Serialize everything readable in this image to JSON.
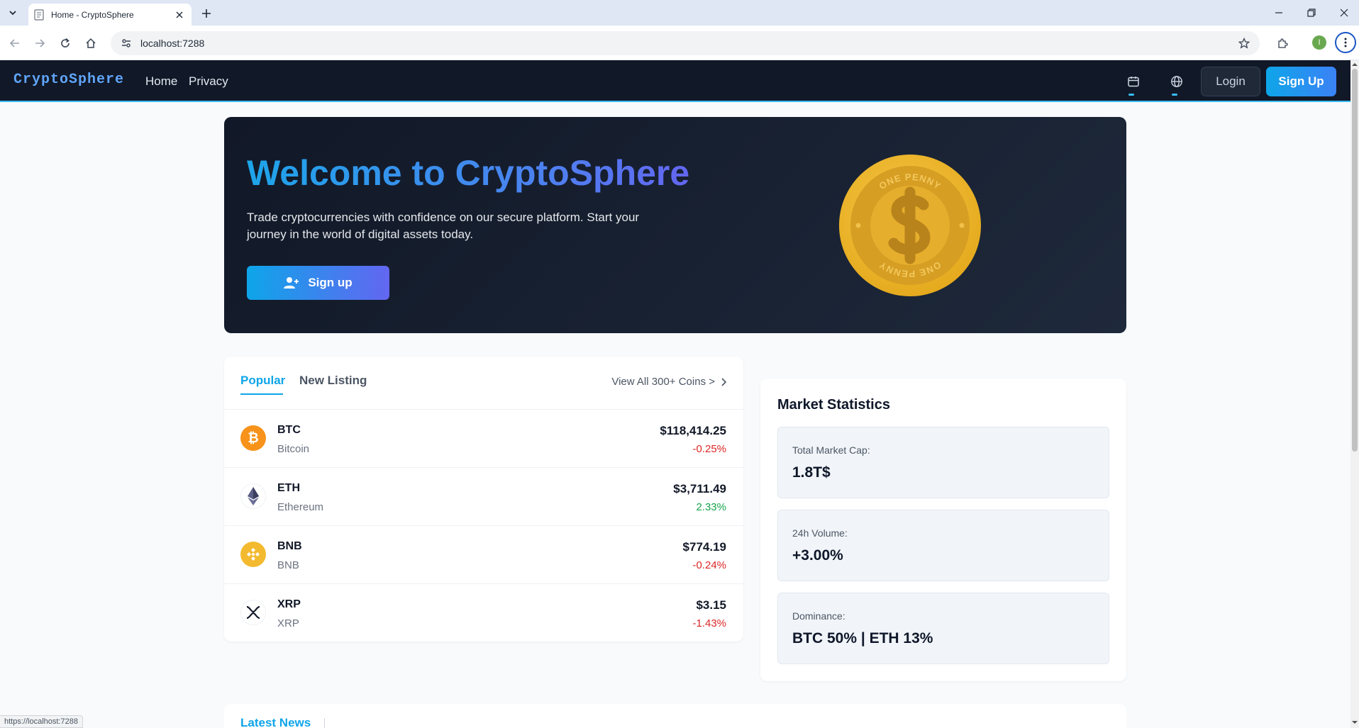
{
  "browser": {
    "tab_title": "Home - CryptoSphere",
    "url": "localhost:7288",
    "profile_initial": "I",
    "status_url": "https://localhost:7288"
  },
  "navbar": {
    "brand": "CryptoSphere",
    "links": [
      "Home",
      "Privacy"
    ],
    "login_label": "Login",
    "signup_label": "Sign Up"
  },
  "hero": {
    "title": "Welcome to CryptoSphere",
    "subtitle": "Trade cryptocurrencies with confidence on our secure platform. Start your journey in the world of digital assets today.",
    "button_label": "Sign up",
    "coin_top_text": "ONE PENNY",
    "coin_bottom_text": "ONE PENNY"
  },
  "coins": {
    "tabs": [
      "Popular",
      "New Listing"
    ],
    "active_tab": "Popular",
    "view_all": "View All 300+ Coins >",
    "rows": [
      {
        "symbol": "BTC",
        "name": "Bitcoin",
        "price": "$118,414.25",
        "change": "-0.25%",
        "direction": "down",
        "logo": "bitcoin-logo-icon"
      },
      {
        "symbol": "ETH",
        "name": "Ethereum",
        "price": "$3,711.49",
        "change": "2.33%",
        "direction": "up",
        "logo": "ethereum-logo-icon"
      },
      {
        "symbol": "BNB",
        "name": "BNB",
        "price": "$774.19",
        "change": "-0.24%",
        "direction": "down",
        "logo": "bnb-logo-icon"
      },
      {
        "symbol": "XRP",
        "name": "XRP",
        "price": "$3.15",
        "change": "-1.43%",
        "direction": "down",
        "logo": "xrp-logo-icon"
      }
    ]
  },
  "stats": {
    "title": "Market Statistics",
    "items": [
      {
        "label": "Total Market Cap:",
        "value": "1.8T$"
      },
      {
        "label": "24h Volume:",
        "value": "+3.00%"
      },
      {
        "label": "Dominance:",
        "value": "BTC 50% | ETH 13%"
      }
    ]
  },
  "news": {
    "tab_label": "Latest News"
  },
  "colors": {
    "accent": "#0ea5e9",
    "positive": "#16a34a",
    "negative": "#dc2626",
    "navbar_bg": "#111827"
  }
}
